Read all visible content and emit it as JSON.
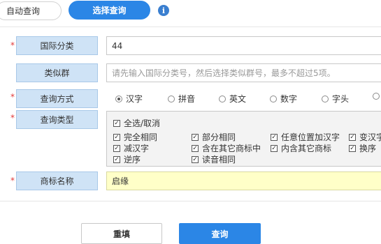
{
  "tabs": {
    "auto_query": "自动查询",
    "choose_query": "选择查询"
  },
  "info_icon": "i",
  "required_mark": "*",
  "intl_class": {
    "label": "国际分类",
    "value": "44"
  },
  "similar_group": {
    "label": "类似群",
    "placeholder": "请先输入国际分类号，然后选择类似群号，最多不超过5项。"
  },
  "query_method": {
    "label": "查询方式",
    "options": [
      "汉字",
      "拼音",
      "英文",
      "数字",
      "字头"
    ],
    "selected": "汉字"
  },
  "query_type": {
    "label": "查询类型",
    "select_all": "全选/取消",
    "options": [
      "完全相同",
      "部分相同",
      "任意位置加汉字",
      "变汉字",
      "减汉字",
      "含在其它商标中",
      "内含其它商标",
      "换序",
      "逆序",
      "读音相同"
    ]
  },
  "trademark_name": {
    "label": "商标名称",
    "value": "启缘"
  },
  "buttons": {
    "reset": "重填",
    "query": "查询"
  },
  "colors": {
    "accent": "#2b86e6",
    "label_bg": "#cfe3f6",
    "required": "#e23a3a",
    "name_bg": "#ffffc8"
  }
}
